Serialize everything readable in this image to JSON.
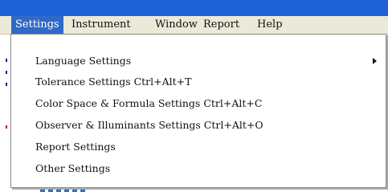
{
  "menubar": {
    "items": [
      {
        "label": "Settings"
      },
      {
        "label": "Instrument"
      },
      {
        "label": "Window"
      },
      {
        "label": "Report"
      },
      {
        "label": "Help"
      }
    ]
  },
  "settings_menu": {
    "items": [
      {
        "label": "Language Settings",
        "has_submenu": true
      },
      {
        "label": "Tolerance Settings Ctrl+Alt+T"
      },
      {
        "label": "Color Space & Formula Settings Ctrl+Alt+C"
      },
      {
        "label": "Observer & Illuminants Settings Ctrl+Alt+O"
      },
      {
        "label": "Report Settings"
      },
      {
        "label": "Other Settings"
      }
    ]
  },
  "colors": {
    "titlebar": "#1f62d6",
    "menubar_bg": "#ece9d8",
    "highlight": "#3169c6"
  }
}
